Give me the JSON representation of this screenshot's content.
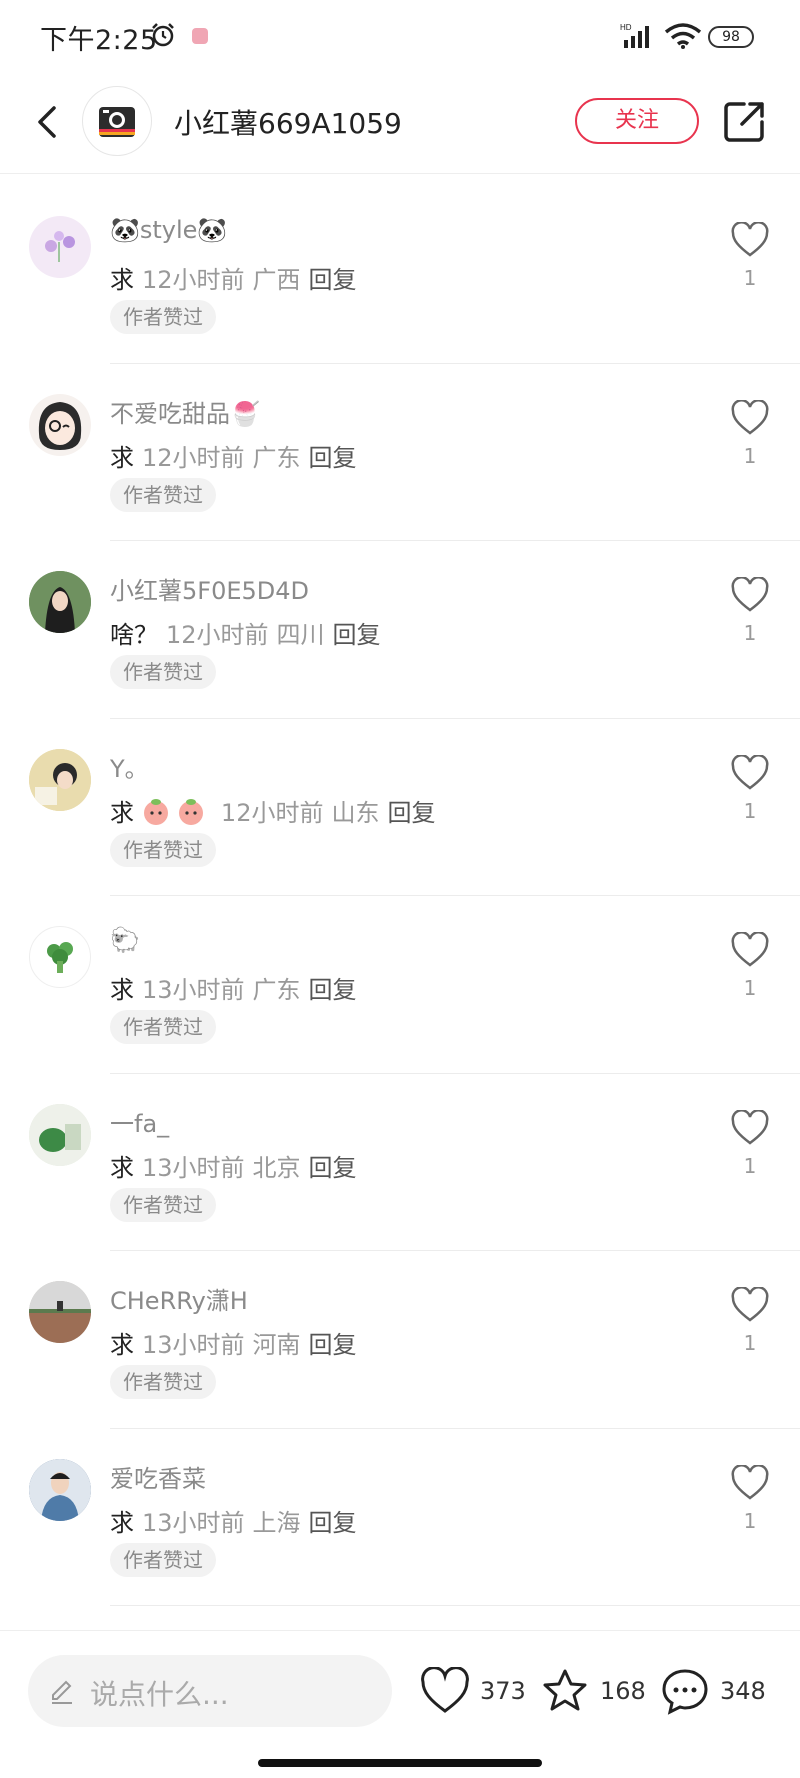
{
  "status_bar": {
    "time": "下午2:25",
    "battery": "98"
  },
  "header": {
    "author_name": "小红薯669A1059",
    "follow_label": "关注"
  },
  "comments": [
    {
      "name": "🐼style🐼",
      "text": "求",
      "time": "12小时前",
      "location": "广西",
      "reply": "回复",
      "badge": "作者赞过",
      "likes": "1",
      "avatar_color": "#f3e9f6"
    },
    {
      "name": "不爱吃甜品🍧",
      "text": "求",
      "time": "12小时前",
      "location": "广东",
      "reply": "回复",
      "badge": "作者赞过",
      "likes": "1",
      "avatar_color": "#f6f1ee"
    },
    {
      "name": "小红薯5F0E5D4D",
      "text": "啥？",
      "time": "12小时前",
      "location": "四川",
      "reply": "回复",
      "badge": "作者赞过",
      "likes": "1",
      "avatar_color": "#7a9a64"
    },
    {
      "name": "Y。",
      "text": "求",
      "time": "12小时前",
      "location": "山东",
      "reply": "回复",
      "badge": "作者赞过",
      "likes": "1",
      "avatar_color": "#e8d9a2"
    },
    {
      "name": "🐑",
      "text": "求",
      "time": "13小时前",
      "location": "广东",
      "reply": "回复",
      "badge": "作者赞过",
      "likes": "1",
      "avatar_color": "#ffffff"
    },
    {
      "name": "一fa_",
      "text": "求",
      "time": "13小时前",
      "location": "北京",
      "reply": "回复",
      "badge": "作者赞过",
      "likes": "1",
      "avatar_color": "#dfe9d8"
    },
    {
      "name": "CHeRRy潇H",
      "text": "求",
      "time": "13小时前",
      "location": "河南",
      "reply": "回复",
      "badge": "作者赞过",
      "likes": "1",
      "avatar_color": "#c8c2b8"
    },
    {
      "name": "爱吃香菜",
      "text": "求",
      "time": "13小时前",
      "location": "上海",
      "reply": "回复",
      "badge": "作者赞过",
      "likes": "1",
      "avatar_color": "#4d6c8f"
    }
  ],
  "bottom_bar": {
    "input_placeholder": "说点什么...",
    "like_count": "373",
    "collect_count": "168",
    "comment_count": "348"
  },
  "colors": {
    "accent": "#e8344e",
    "muted": "#999999"
  }
}
